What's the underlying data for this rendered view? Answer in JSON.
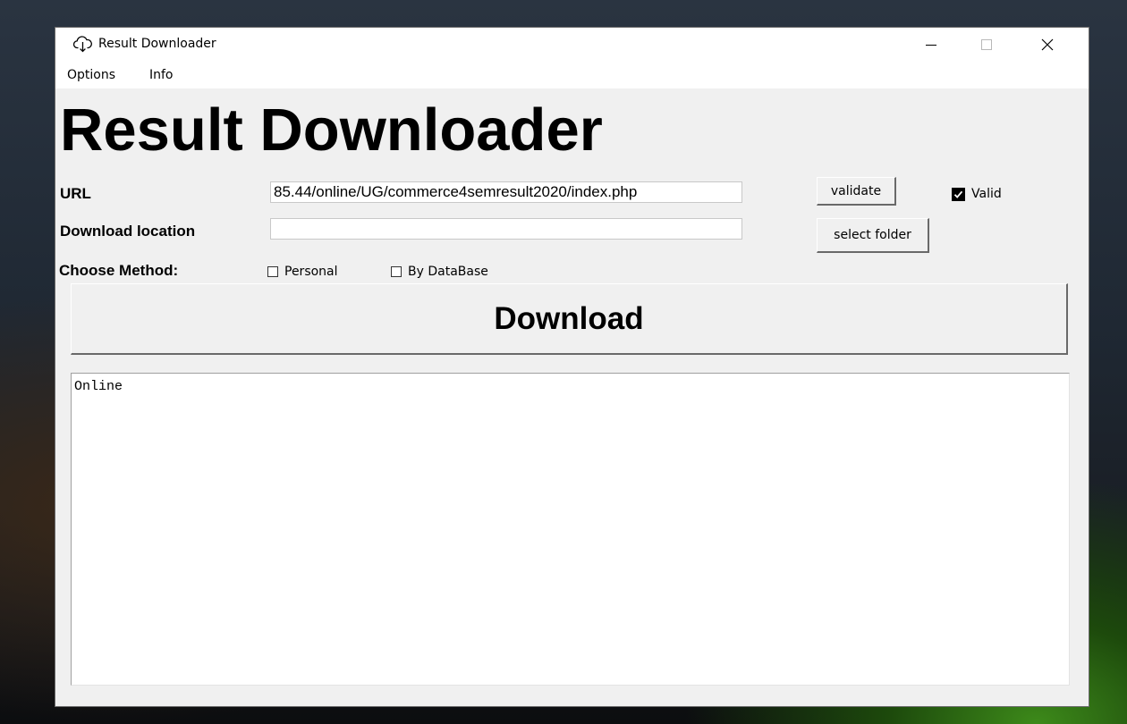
{
  "window": {
    "title": "Result Downloader",
    "controls": {
      "minimize_icon": "minimize-icon",
      "maximize_icon": "maximize-icon",
      "close_icon": "close-icon"
    }
  },
  "menu": {
    "items": [
      "Options",
      "Info"
    ]
  },
  "heading": "Result Downloader",
  "form": {
    "url_label": "URL",
    "url_value": "85.44/online/UG/commerce4semresult2020/index.php",
    "location_label": "Download location",
    "location_value": "",
    "validate_button": "validate",
    "select_folder_button": "select folder",
    "valid_label": "Valid",
    "valid_checked": true,
    "method_label": "Choose Method:",
    "method_options": [
      {
        "label": "Personal",
        "checked": false
      },
      {
        "label": "By DataBase",
        "checked": false
      }
    ]
  },
  "download_button": "Download",
  "console": {
    "text": "Online"
  },
  "colors": {
    "window_bg": "#f0f0f0",
    "titlebar_bg": "#ffffff",
    "text": "#000000"
  }
}
